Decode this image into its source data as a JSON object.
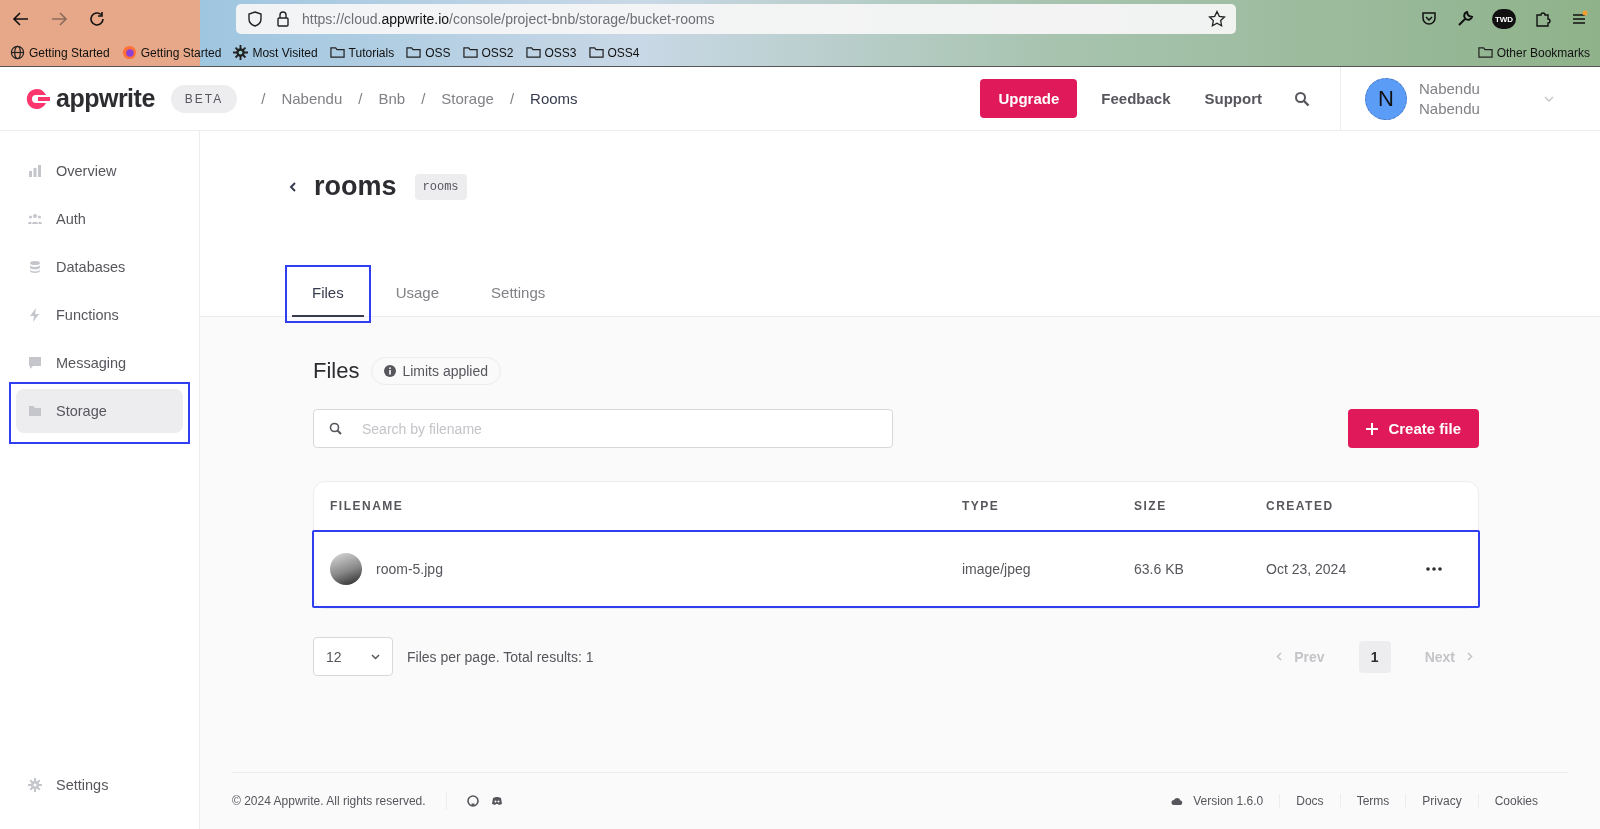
{
  "browser": {
    "url": "https://cloud.**appwrite.io**/console/project-bnb/storage/bucket-rooms",
    "bookmarks": [
      {
        "kind": "globe",
        "label": "Getting Started"
      },
      {
        "kind": "firefox",
        "label": "Getting Started"
      },
      {
        "kind": "gear",
        "label": "Most Visited"
      },
      {
        "kind": "folder",
        "label": "Tutorials"
      },
      {
        "kind": "folder",
        "label": "OSS"
      },
      {
        "kind": "folder",
        "label": "OSS2"
      },
      {
        "kind": "folder",
        "label": "OSS3"
      },
      {
        "kind": "folder",
        "label": "OSS4"
      }
    ],
    "other_bookmarks": "Other Bookmarks",
    "profile_badge": "TWD"
  },
  "header": {
    "logo": "appwrite",
    "badge": "BETA",
    "breadcrumbs": [
      {
        "separator": "/",
        "label": "Nabendu",
        "selected": false
      },
      {
        "separator": "/",
        "label": "Bnb",
        "selected": false
      },
      {
        "separator": "/",
        "label": "Storage",
        "selected": false
      },
      {
        "separator": "/",
        "label": "Rooms",
        "selected": true
      }
    ],
    "upgrade": "Upgrade",
    "feedback": "Feedback",
    "support": "Support",
    "user": {
      "initial": "N",
      "name": "Nabendu",
      "subtitle": "Nabendu"
    }
  },
  "sidebar": {
    "items": [
      {
        "kind": "chart",
        "label": "Overview",
        "selected": false,
        "highlighted": false
      },
      {
        "kind": "people",
        "label": "Auth",
        "selected": false,
        "highlighted": false
      },
      {
        "kind": "database",
        "label": "Databases",
        "selected": false,
        "highlighted": false
      },
      {
        "kind": "bolt",
        "label": "Functions",
        "selected": false,
        "highlighted": false
      },
      {
        "kind": "chat",
        "label": "Messaging",
        "selected": false,
        "highlighted": false
      },
      {
        "kind": "folder",
        "label": "Storage",
        "selected": true,
        "highlighted": true
      }
    ],
    "settings": "Settings"
  },
  "page": {
    "title": "rooms",
    "id": "rooms",
    "tabs": [
      {
        "label": "Files",
        "selected": true,
        "highlighted": true
      },
      {
        "label": "Usage",
        "selected": false,
        "highlighted": false
      },
      {
        "label": "Settings",
        "selected": false,
        "highlighted": false
      }
    ]
  },
  "files": {
    "heading": "Files",
    "limits": "Limits applied",
    "search": {
      "placeholder": "Search by filename"
    },
    "create": "Create file",
    "table": {
      "columns": [
        "FILENAME",
        "TYPE",
        "SIZE",
        "CREATED"
      ],
      "rows": [
        {
          "filename": "room-5.jpg",
          "type": "image/jpeg",
          "size": "63.6 KB",
          "created": "Oct 23, 2024",
          "highlighted": true
        }
      ]
    },
    "per_page": "12",
    "per_page_text": "Files per page. Total results: 1",
    "pagination": {
      "prev": "Prev",
      "prev_disabled": true,
      "page": "1",
      "next": "Next",
      "next_disabled": true
    }
  },
  "footer": {
    "copyright": "© 2024 Appwrite. All rights reserved.",
    "version": "Version 1.6.0",
    "links": [
      "Docs",
      "Terms",
      "Privacy",
      "Cookies"
    ]
  }
}
